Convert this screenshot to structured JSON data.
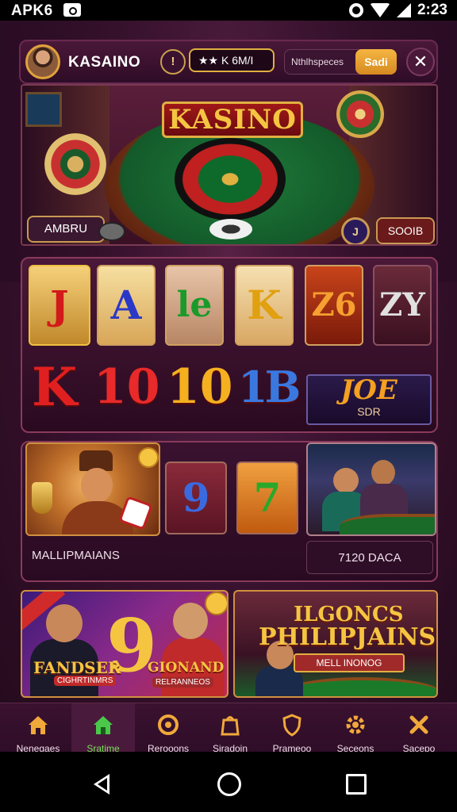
{
  "status_bar": {
    "carrier": "APK6",
    "time": "2:23",
    "icons": [
      "gear-icon",
      "wifi-icon",
      "signal-icon"
    ]
  },
  "header": {
    "brand": "KASAINO",
    "info_glyph": "!",
    "balance": "★★ K 6M/I",
    "search_placeholder": "Nthlhspeces",
    "search_button": "Sadi",
    "close_glyph": "✕"
  },
  "hero": {
    "sign": "KASINO",
    "left_button": "AMBRU",
    "icon_glyph": "J",
    "right_button": "SOOIB"
  },
  "slots": {
    "tiles": [
      "J",
      "A",
      "le",
      "K",
      "Z6",
      "ZY"
    ],
    "big_row": [
      "K",
      "10",
      "10",
      "1B"
    ],
    "feature_title": "JOE",
    "feature_sub": "SDR"
  },
  "middle": {
    "numbers": [
      "9",
      "7"
    ],
    "label": "MALLIPMAIANS",
    "code": "7120 DACA"
  },
  "promos": {
    "left": {
      "title_a": "FANDSER",
      "sub_a": "CIGHRTINMRS",
      "title_b": "GIONAND",
      "sub_b": "RELRANNEOS"
    },
    "right": {
      "title_a": "ILGONCS",
      "title_b": "PHILIPJAINS",
      "banner": "MELL INONOG"
    }
  },
  "bottom_nav": {
    "active": 1,
    "items": [
      {
        "label": "Nenegaes",
        "icon": "home-icon"
      },
      {
        "label": "Sratime",
        "icon": "house-icon"
      },
      {
        "label": "Rerooons",
        "icon": "badge-icon"
      },
      {
        "label": "Siradoin",
        "icon": "bag-icon"
      },
      {
        "label": "Prameoo",
        "icon": "shield-icon"
      },
      {
        "label": "Seceons",
        "icon": "settings-icon"
      },
      {
        "label": "Sacepo",
        "icon": "tools-icon"
      }
    ]
  },
  "colors": {
    "accent": "#f5c542",
    "nav_active": "#7ae05a",
    "background": "#3a1230"
  }
}
